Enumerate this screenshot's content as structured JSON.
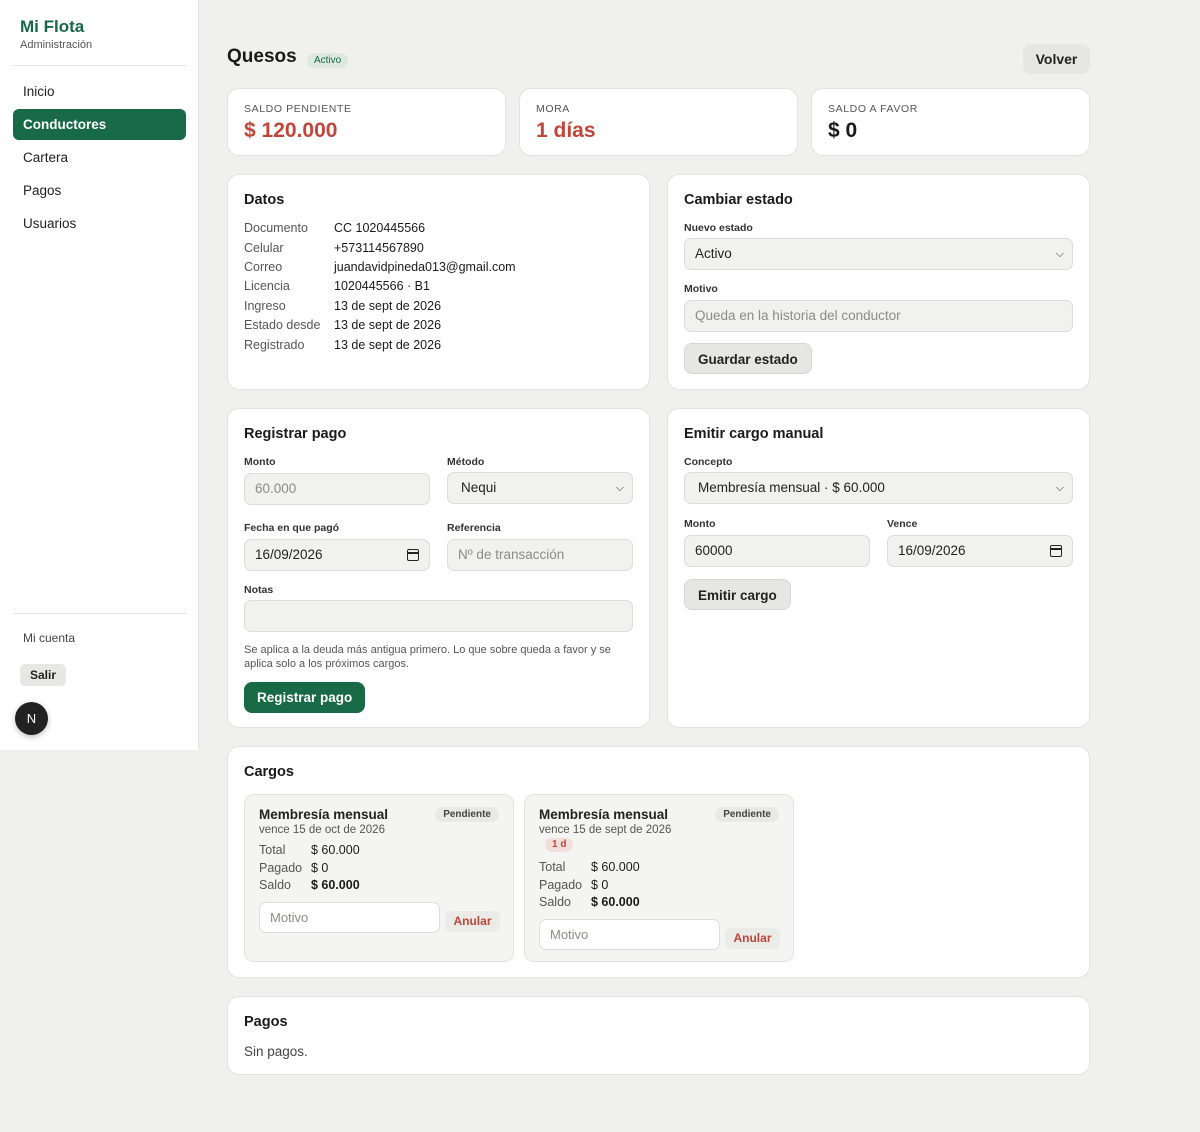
{
  "sidebar": {
    "brand_title": "Mi Flota",
    "brand_subtitle": "Administración",
    "items": [
      {
        "label": "Inicio"
      },
      {
        "label": "Conductores"
      },
      {
        "label": "Cartera"
      },
      {
        "label": "Pagos"
      },
      {
        "label": "Usuarios"
      }
    ],
    "active_item": "Conductores",
    "account_label": "Mi cuenta",
    "logout_label": "Salir",
    "avatar_letter": "N"
  },
  "header": {
    "title": "Quesos",
    "status_badge": "Activo",
    "back_label": "Volver"
  },
  "stats": [
    {
      "label": "SALDO PENDIENTE",
      "value": "$ 120.000"
    },
    {
      "label": "MORA",
      "value": "1 días"
    },
    {
      "label": "SALDO A FAVOR",
      "value": "$ 0"
    }
  ],
  "datos": {
    "title": "Datos",
    "rows": [
      {
        "key": "Documento",
        "value": "CC 1020445566"
      },
      {
        "key": "Celular",
        "value": "+573114567890"
      },
      {
        "key": "Correo",
        "value": "juandavidpineda013@gmail.com"
      },
      {
        "key": "Licencia",
        "value": "1020445566 · B1"
      },
      {
        "key": "Ingreso",
        "value": "13 de sept de 2026"
      },
      {
        "key": "Estado desde",
        "value": "13 de sept de 2026"
      },
      {
        "key": "Registrado",
        "value": "13 de sept de 2026"
      }
    ]
  },
  "cambiar_estado": {
    "title": "Cambiar estado",
    "nuevo_estado_label": "Nuevo estado",
    "nuevo_estado_value": "Activo",
    "motivo_label": "Motivo",
    "motivo_placeholder": "Queda en la historia del conductor",
    "save_label": "Guardar estado"
  },
  "registrar_pago": {
    "title": "Registrar pago",
    "monto_label": "Monto",
    "monto_placeholder": "60.000",
    "metodo_label": "Método",
    "metodo_value": "Nequi",
    "fecha_label": "Fecha en que pagó",
    "fecha_value": "16/09/2026",
    "referencia_label": "Referencia",
    "referencia_placeholder": "Nº de transacción",
    "notas_label": "Notas",
    "notas_value": "",
    "help": "Se aplica a la deuda más antigua primero. Lo que sobre queda a favor y se aplica solo a los próximos cargos.",
    "submit_label": "Registrar pago"
  },
  "emitir_cargo": {
    "title": "Emitir cargo manual",
    "concepto_label": "Concepto",
    "concepto_value": "Membresía mensual · $ 60.000",
    "monto_label": "Monto",
    "monto_value": "60000",
    "vence_label": "Vence",
    "vence_value": "16/09/2026",
    "submit_label": "Emitir cargo"
  },
  "cargos": {
    "title": "Cargos",
    "items": [
      {
        "title": "Membresía mensual",
        "due": "vence 15 de oct de 2026",
        "badge": "Pendiente",
        "late": "",
        "total_label": "Total",
        "total": "$ 60.000",
        "pagado_label": "Pagado",
        "pagado": "$ 0",
        "saldo_label": "Saldo",
        "saldo": "$ 60.000",
        "motivo_placeholder": "Motivo",
        "void_label": "Anular"
      },
      {
        "title": "Membresía mensual",
        "due": "vence 15 de sept de 2026",
        "badge": "Pendiente",
        "late": "1 d",
        "total_label": "Total",
        "total": "$ 60.000",
        "pagado_label": "Pagado",
        "pagado": "$ 0",
        "saldo_label": "Saldo",
        "saldo": "$ 60.000",
        "motivo_placeholder": "Motivo",
        "void_label": "Anular"
      }
    ]
  },
  "pagos": {
    "title": "Pagos",
    "empty": "Sin pagos."
  },
  "colors": {
    "brand": "#176a45",
    "danger": "#c0463a",
    "background": "#f0f0ee"
  },
  "icons": [
    "chevron-down-icon",
    "calendar-icon"
  ]
}
